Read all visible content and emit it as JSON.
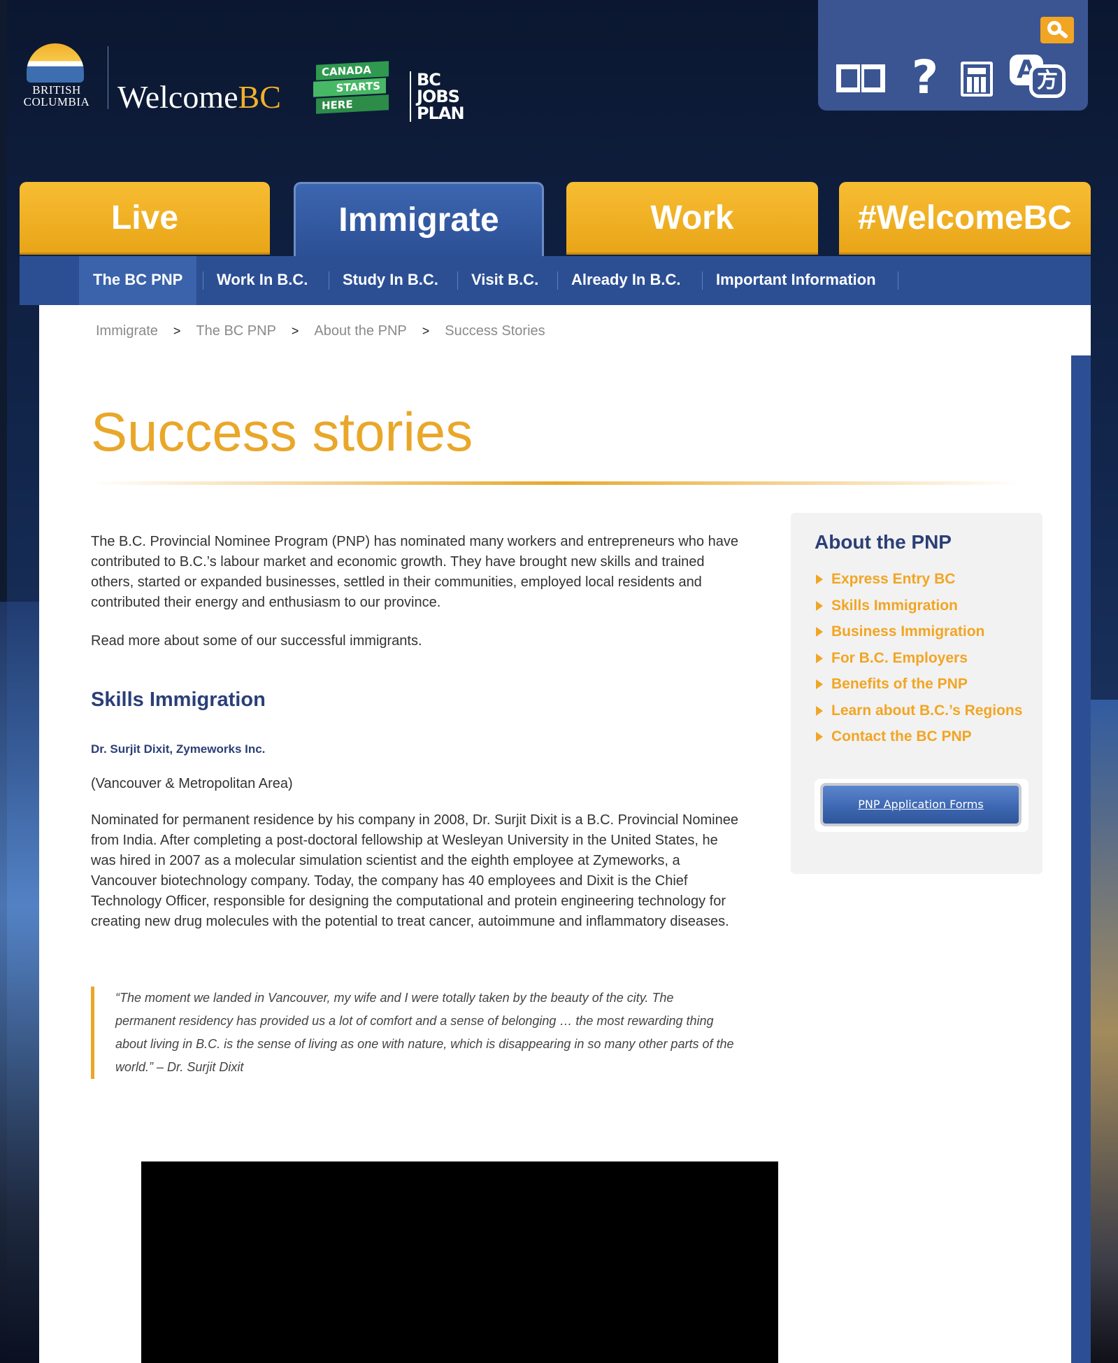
{
  "brand": {
    "bc_logo_text": "BRITISH COLUMBIA",
    "welcome_prefix": "Welcome",
    "welcome_suffix": "BC",
    "canada_starts_here": [
      "CANADA",
      "STARTS",
      "HERE"
    ],
    "bc_jobs_plan": "BC JOBS PLAN"
  },
  "tools": {
    "search": "search-icon",
    "glossary": "book-icon",
    "help": "?",
    "calculator": "calculator-icon",
    "translate_a": "A",
    "translate_b": "方"
  },
  "main_tabs": [
    {
      "label": "Live",
      "active": false
    },
    {
      "label": "Immigrate",
      "active": true
    },
    {
      "label": "Work",
      "active": false
    },
    {
      "label": "#WelcomeBC",
      "active": false
    }
  ],
  "sub_nav": [
    {
      "label": "The BC PNP",
      "active": true
    },
    {
      "label": "Work In B.C.",
      "active": false
    },
    {
      "label": "Study In B.C.",
      "active": false
    },
    {
      "label": "Visit B.C.",
      "active": false
    },
    {
      "label": "Already In B.C.",
      "active": false
    },
    {
      "label": "Important Information",
      "active": false
    }
  ],
  "breadcrumb": [
    "Immigrate",
    "The BC PNP",
    "About the PNP",
    "Success Stories"
  ],
  "breadcrumb_separator": ">",
  "page": {
    "title": "Success stories",
    "intro": "The B.C. Provincial Nominee Program (PNP) has nominated many workers and entrepreneurs who have contributed to B.C.’s labour market and economic growth. They have brought new skills and trained others, started or expanded businesses, settled in their communities, employed local residents and contributed their energy and enthusiasm to our province.",
    "read_more": "Read more about some of our successful immigrants.",
    "section_heading": "Skills Immigration",
    "person_heading": "Dr. Surjit Dixit, Zymeworks Inc.",
    "location": "(Vancouver & Metropolitan Area)",
    "bio": "Nominated for permanent residence by his company in 2008, Dr. Surjit Dixit is a B.C. Provincial Nominee from India. After completing a post-doctoral fellowship at Wesleyan University in the United States, he was hired in 2007 as a molecular simulation scientist and the eighth employee at Zymeworks, a Vancouver biotechnology company. Today, the company has 40 employees and Dixit is the Chief Technology Officer, responsible for designing the computational and protein engineering technology for creating new drug molecules with the potential to treat cancer, autoimmune and inflammatory diseases.",
    "quote": "“The moment we landed in Vancouver, my wife and I were totally taken by the beauty of the city. The permanent residency has provided us a lot of comfort and a sense of belonging … the most rewarding thing about living in B.C. is the sense of living as one with nature, which is disappearing in so many other parts of the world.” – Dr. Surjit Dixit"
  },
  "sidebar": {
    "title": "About the PNP",
    "links": [
      "Express Entry BC",
      "Skills Immigration",
      "Business Immigration",
      "For B.C. Employers",
      "Benefits of the PNP",
      "Learn about B.C.’s Regions",
      "Contact the BC PNP"
    ],
    "button_label": "PNP Application Forms"
  },
  "colors": {
    "gold": "#f2a523",
    "navy": "#2c4f94",
    "heading_blue": "#2b3f77",
    "title_gold": "#e9a72a"
  }
}
